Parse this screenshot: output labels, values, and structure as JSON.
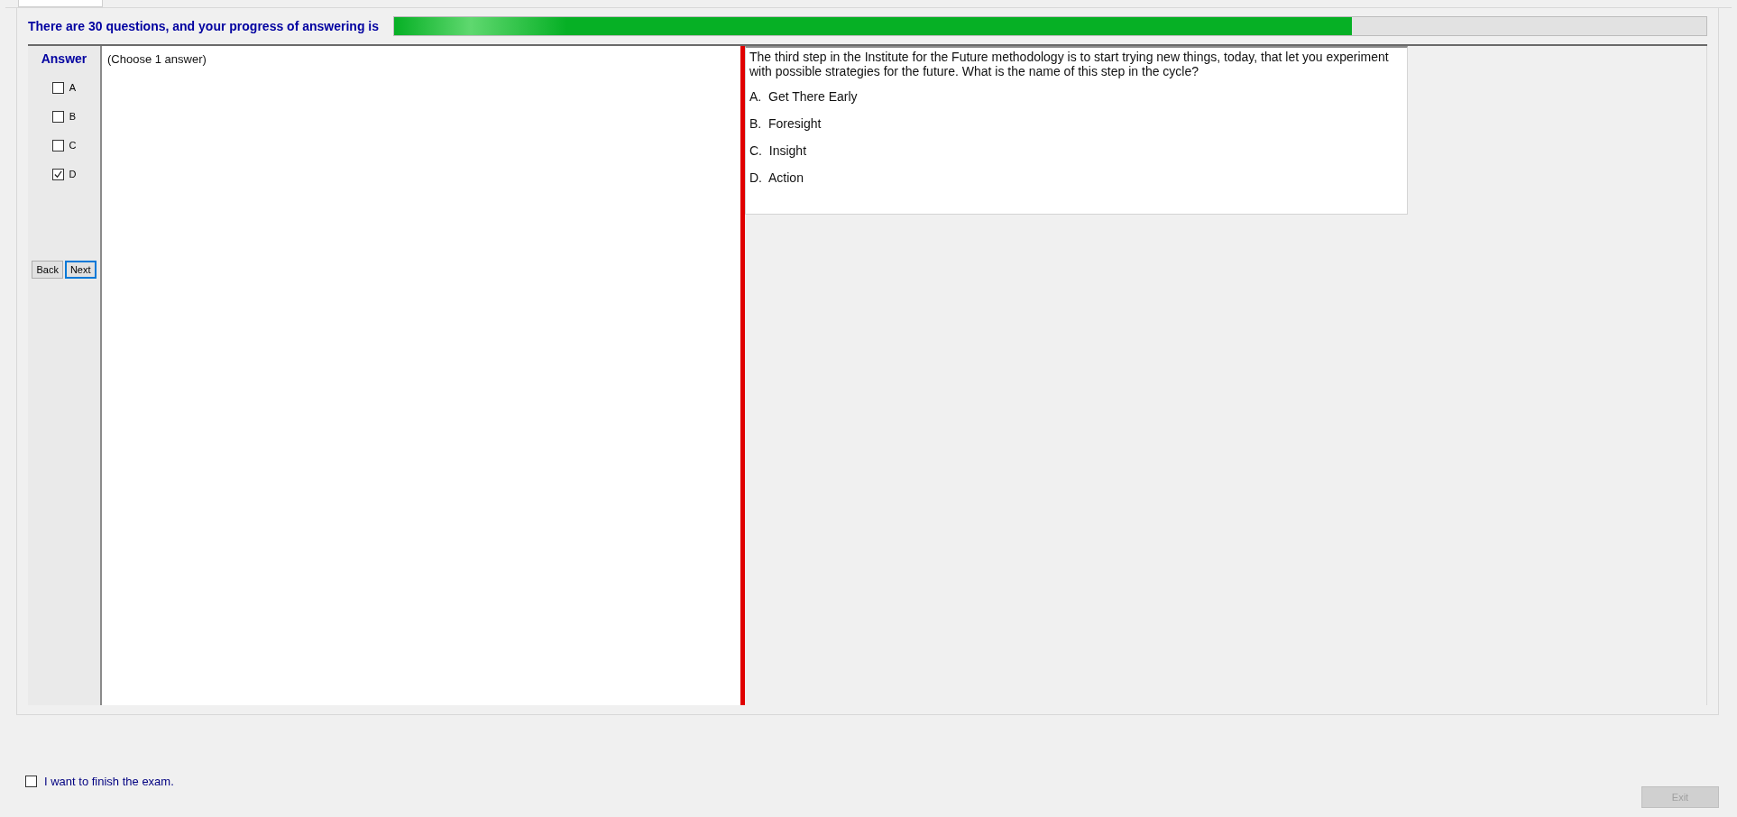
{
  "header": {
    "text": "There are 30 questions, and your progress of answering is",
    "progress": {
      "level": 0.73
    }
  },
  "answer_panel": {
    "title": "Answer",
    "options": [
      {
        "label": "A",
        "checked": false
      },
      {
        "label": "B",
        "checked": false
      },
      {
        "label": "C",
        "checked": false
      },
      {
        "label": "D",
        "checked": true
      }
    ],
    "buttons": [
      {
        "label": "Back",
        "focused": false
      },
      {
        "label": "Next",
        "focused": true
      }
    ]
  },
  "answer_hint": "(Choose 1 answer)",
  "question": {
    "text": "The third step in the Institute for the Future methodology is to start trying new things, today, that let you experiment with possible strategies for the future. What is the name of this step in the cycle?",
    "choices": [
      "A.  Get There Early",
      "B.  Foresight",
      "C.  Insight",
      "D.  Action"
    ]
  },
  "finish": {
    "label": "I want to finish the exam.",
    "checked": false
  },
  "exit_button": {
    "label": "Exit",
    "disabled": true
  }
}
